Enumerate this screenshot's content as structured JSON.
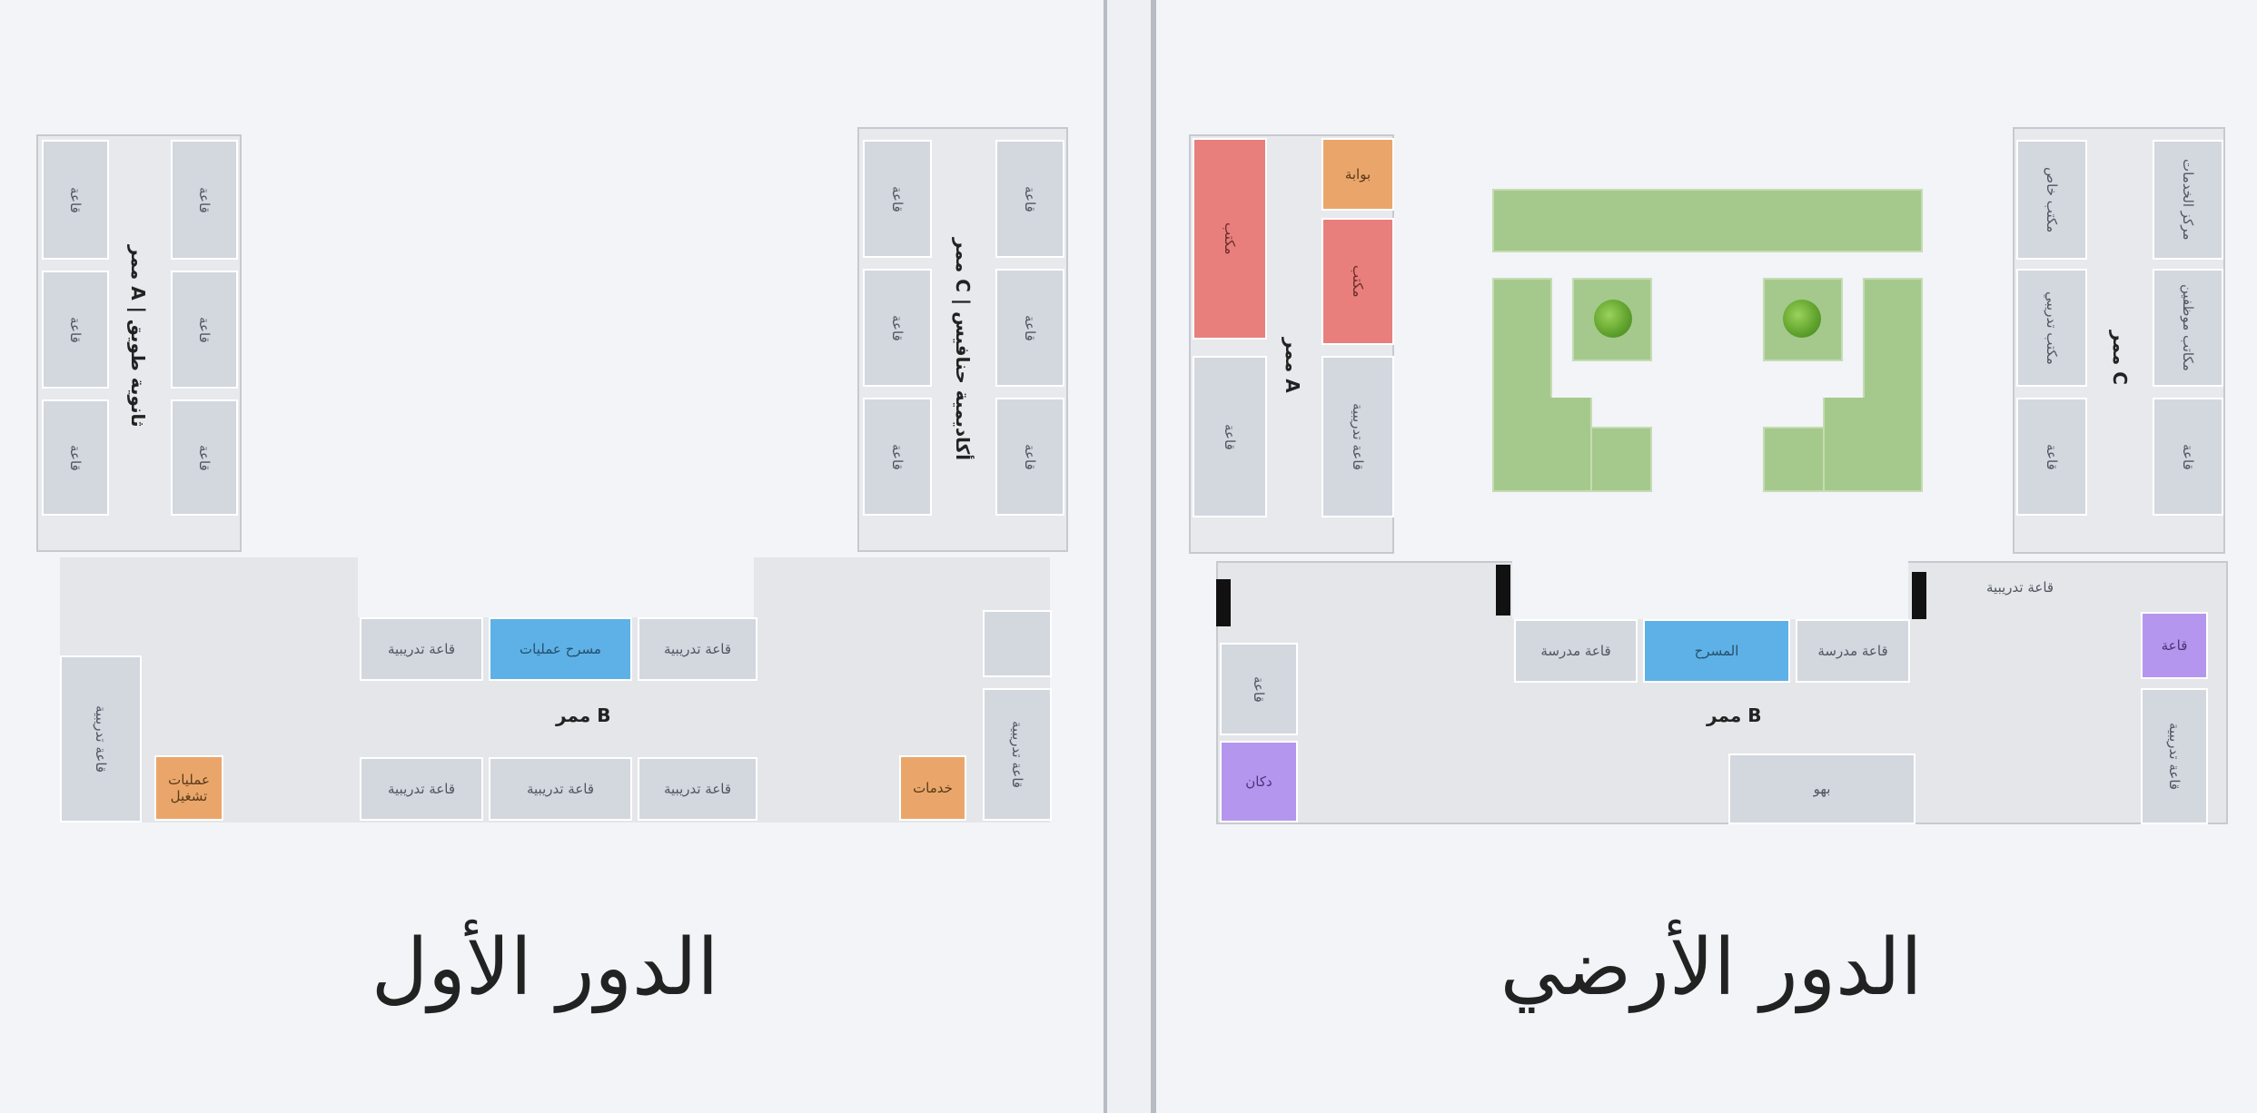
{
  "first_floor": {
    "title": "الدور الأول",
    "wing_a_label": "ممر A | ثانوية طويق",
    "wing_c_label": "ممر C | أكاديمية حنافيس",
    "corridor_b_label": "ممر B",
    "wing_a_rooms": [
      "قاعة",
      "قاعة",
      "قاعة",
      "قاعة",
      "قاعة",
      "قاعة"
    ],
    "wing_c_rooms": [
      "قاعة",
      "قاعة",
      "قاعة",
      "قاعة",
      "قاعة",
      "قاعة"
    ],
    "corridor_rooms": {
      "left_vertical": "قاعة تدريبية",
      "orange_left": "عمليات تشغيل",
      "top_1": "قاعة تدريبية",
      "blue": "مسرح عمليات",
      "top_3": "قاعة تدريبية",
      "bottom_1": "قاعة تدريبية",
      "bottom_2": "قاعة تدريبية",
      "bottom_3": "قاعة تدريبية",
      "orange_right": "خدمات",
      "right_vertical": "قاعة تدريبية"
    }
  },
  "ground_floor": {
    "title": "الدور الأرضي",
    "wing_a_label": "ممر A",
    "wing_c_label": "ممر C",
    "corridor_b_label": "ممر B",
    "wing_a_rooms": {
      "red_tall": "مكتب",
      "orange": "بوابة",
      "red": "مكتب",
      "grey_left": "قاعة",
      "grey_right": "قاعة تدريبية"
    },
    "wing_c_rooms": {
      "r1_left": "مكتب خاص",
      "r1_right": "مركز الخدمات",
      "r2_left": "مكتب تدريبي",
      "r2_right": "مكاتب موظفين",
      "r3_left": "قاعة",
      "r3_right": "قاعة"
    },
    "corridor_rooms": {
      "top_right_label": "قاعة تدريبية",
      "top_1": "قاعة مدرسة",
      "blue": "المسرح",
      "top_3": "قاعة مدرسة",
      "purple_right": "قاعة",
      "right_vertical": "قاعة تدريبية",
      "left_small": "قاعة",
      "purple_left": "دكان",
      "bottom_center": "بهو"
    }
  },
  "colors": {
    "background": "#f2f4f8",
    "wing": "#e7e9ec",
    "room": "#d3d7de",
    "blue": "#5eb1e6",
    "orange": "#eaa66a",
    "red": "#e87f7c",
    "purple": "#b596ee",
    "green": "#a5c98c"
  },
  "icons": [
    "tree-icon"
  ]
}
